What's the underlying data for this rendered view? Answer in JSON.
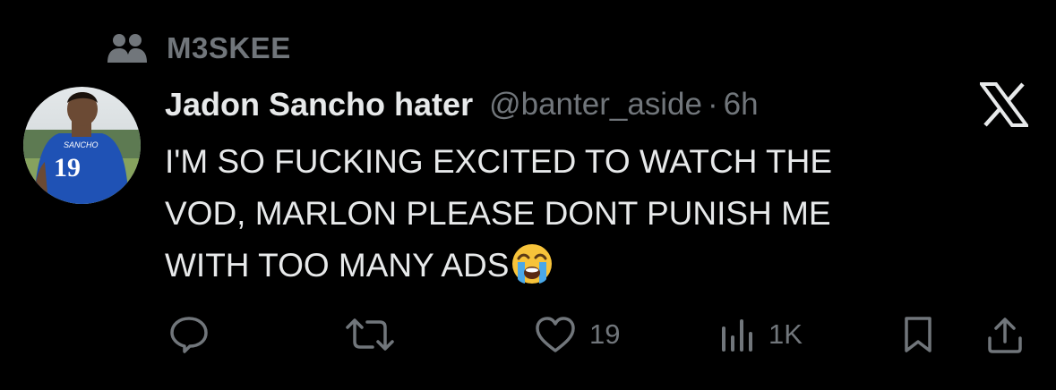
{
  "context": {
    "label": "M3SKEE",
    "icon": "people-icon"
  },
  "author": {
    "display_name": "Jadon Sancho hater",
    "handle": "@banter_aside",
    "separator": "·",
    "time": "6h",
    "avatar": "avatar-photo"
  },
  "tweet": {
    "lines": [
      "I'M SO FUCKING EXCITED TO WATCH THE",
      "VOD, MARLON PLEASE DONT PUNISH ME",
      "WITH TOO MANY ADS"
    ],
    "emoji": "loudly-crying-face"
  },
  "actions": {
    "reply": {
      "icon": "reply-icon"
    },
    "retweet": {
      "icon": "retweet-icon"
    },
    "like": {
      "icon": "heart-icon",
      "count": "19"
    },
    "views": {
      "icon": "views-icon",
      "count": "1K"
    },
    "bookmark": {
      "icon": "bookmark-icon"
    },
    "share": {
      "icon": "share-icon"
    }
  },
  "colors": {
    "background": "#000000",
    "text": "#e7e9ea",
    "muted": "#71767b"
  }
}
